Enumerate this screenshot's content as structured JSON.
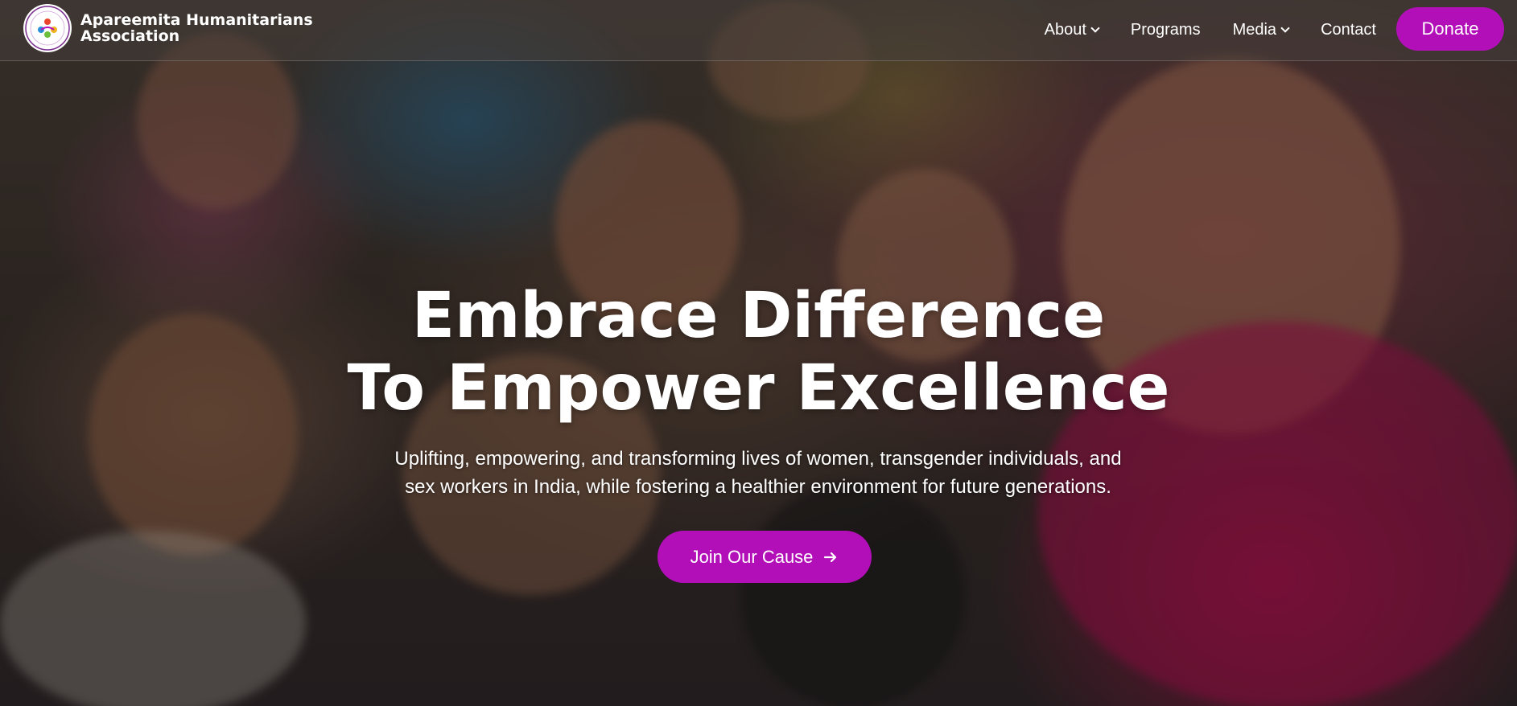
{
  "brand": {
    "name_line1": "Apareemita Humanitarians",
    "name_line2": "Association",
    "logo_icon": "organization-logo-icon"
  },
  "nav": {
    "items": [
      {
        "label": "About",
        "has_dropdown": true
      },
      {
        "label": "Programs",
        "has_dropdown": false
      },
      {
        "label": "Media",
        "has_dropdown": true
      },
      {
        "label": "Contact",
        "has_dropdown": false
      }
    ],
    "donate_label": "Donate"
  },
  "hero": {
    "headline_line1": "Embrace Difference",
    "headline_line2": "To Empower Excellence",
    "subtitle_line1": "Uplifting, empowering, and transforming lives of women, transgender individuals, and",
    "subtitle_line2": "sex workers in India, while fostering a healthier environment for future generations.",
    "cta_label": "Join Our Cause",
    "cta_icon": "arrow-right-icon"
  },
  "colors": {
    "accent": "#b30fb8",
    "text": "#ffffff"
  }
}
